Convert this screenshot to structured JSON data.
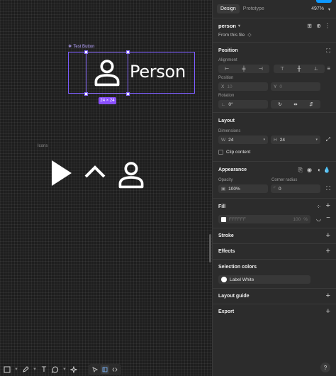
{
  "canvas": {
    "frame_label": "Test Button",
    "person_label": "Person",
    "size_badge": "24 × 24",
    "icons_label": "Icons"
  },
  "toolbar": {
    "tools": [
      "move-tool",
      "pen-tool",
      "text-tool",
      "comment-tool",
      "actions-tool"
    ],
    "text_glyph": "T",
    "modes": [
      "design-mode",
      "dev-mode"
    ]
  },
  "panel": {
    "tabs": [
      "Design",
      "Prototype"
    ],
    "active_tab": "Design",
    "zoom": "497%",
    "component": {
      "name": "person",
      "source": "From this file"
    },
    "position": {
      "title": "Position",
      "alignment_label": "Alignment",
      "position_label": "Position",
      "x_label": "X",
      "x_value": "10",
      "y_label": "Y",
      "y_value": "0",
      "rotation_label": "Rotation",
      "rotation_value": "0°"
    },
    "layout": {
      "title": "Layout",
      "dimensions_label": "Dimensions",
      "w_label": "W",
      "w_value": "24",
      "h_label": "H",
      "h_value": "24",
      "clip_content": "Clip content"
    },
    "appearance": {
      "title": "Appearance",
      "opacity_label": "Opacity",
      "opacity_value": "100%",
      "radius_label": "Corner radius",
      "radius_value": "0"
    },
    "fill": {
      "title": "Fill",
      "hex": "FFFFFF",
      "opacity": "100",
      "unit": "%"
    },
    "stroke": {
      "title": "Stroke"
    },
    "effects": {
      "title": "Effects"
    },
    "selection_colors": {
      "title": "Selection colors",
      "color_name": "Label White"
    },
    "layout_guide": {
      "title": "Layout guide"
    },
    "export": {
      "title": "Export"
    },
    "help": "?"
  },
  "colors": {
    "canvas_bg": "#1e1e1e",
    "panel_bg": "#2c2c2c",
    "selection": "#8a6cff",
    "badge": "#8a4fff",
    "accent_blue": "#0d99ff",
    "icon_white": "#ffffff"
  }
}
